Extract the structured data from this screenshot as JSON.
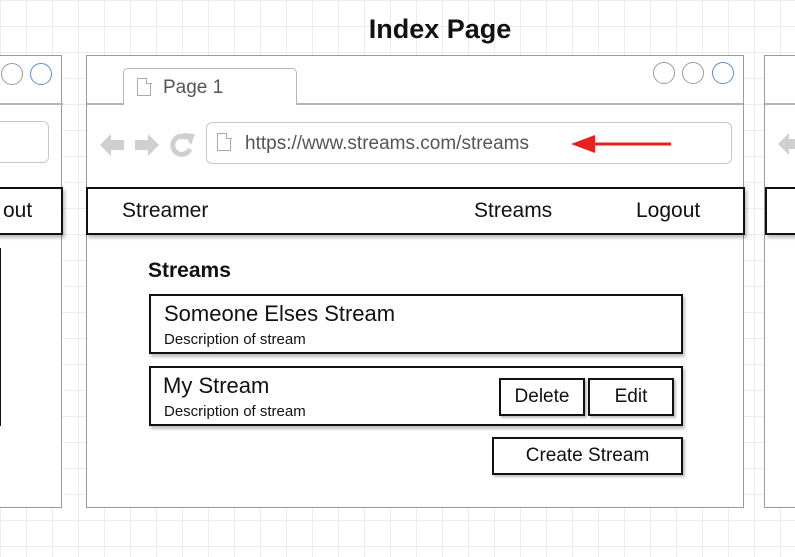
{
  "title": "Index Page",
  "browser": {
    "tab_label": "Page 1",
    "url": "https://www.streams.com/streams"
  },
  "navbar": {
    "brand": "Streamer",
    "streams_link": "Streams",
    "logout_link": "Logout"
  },
  "left_partial": {
    "nav_fragment": "out"
  },
  "content": {
    "heading": "Streams",
    "streams": [
      {
        "title": "Someone Elses Stream",
        "description": "Description of stream"
      },
      {
        "title": "My Stream",
        "description": "Description of stream"
      }
    ],
    "delete_label": "Delete",
    "edit_label": "Edit",
    "create_label": "Create Stream"
  },
  "colors": {
    "arrow": "#e8201c",
    "window_circle_accent": "#5a8ed6"
  }
}
